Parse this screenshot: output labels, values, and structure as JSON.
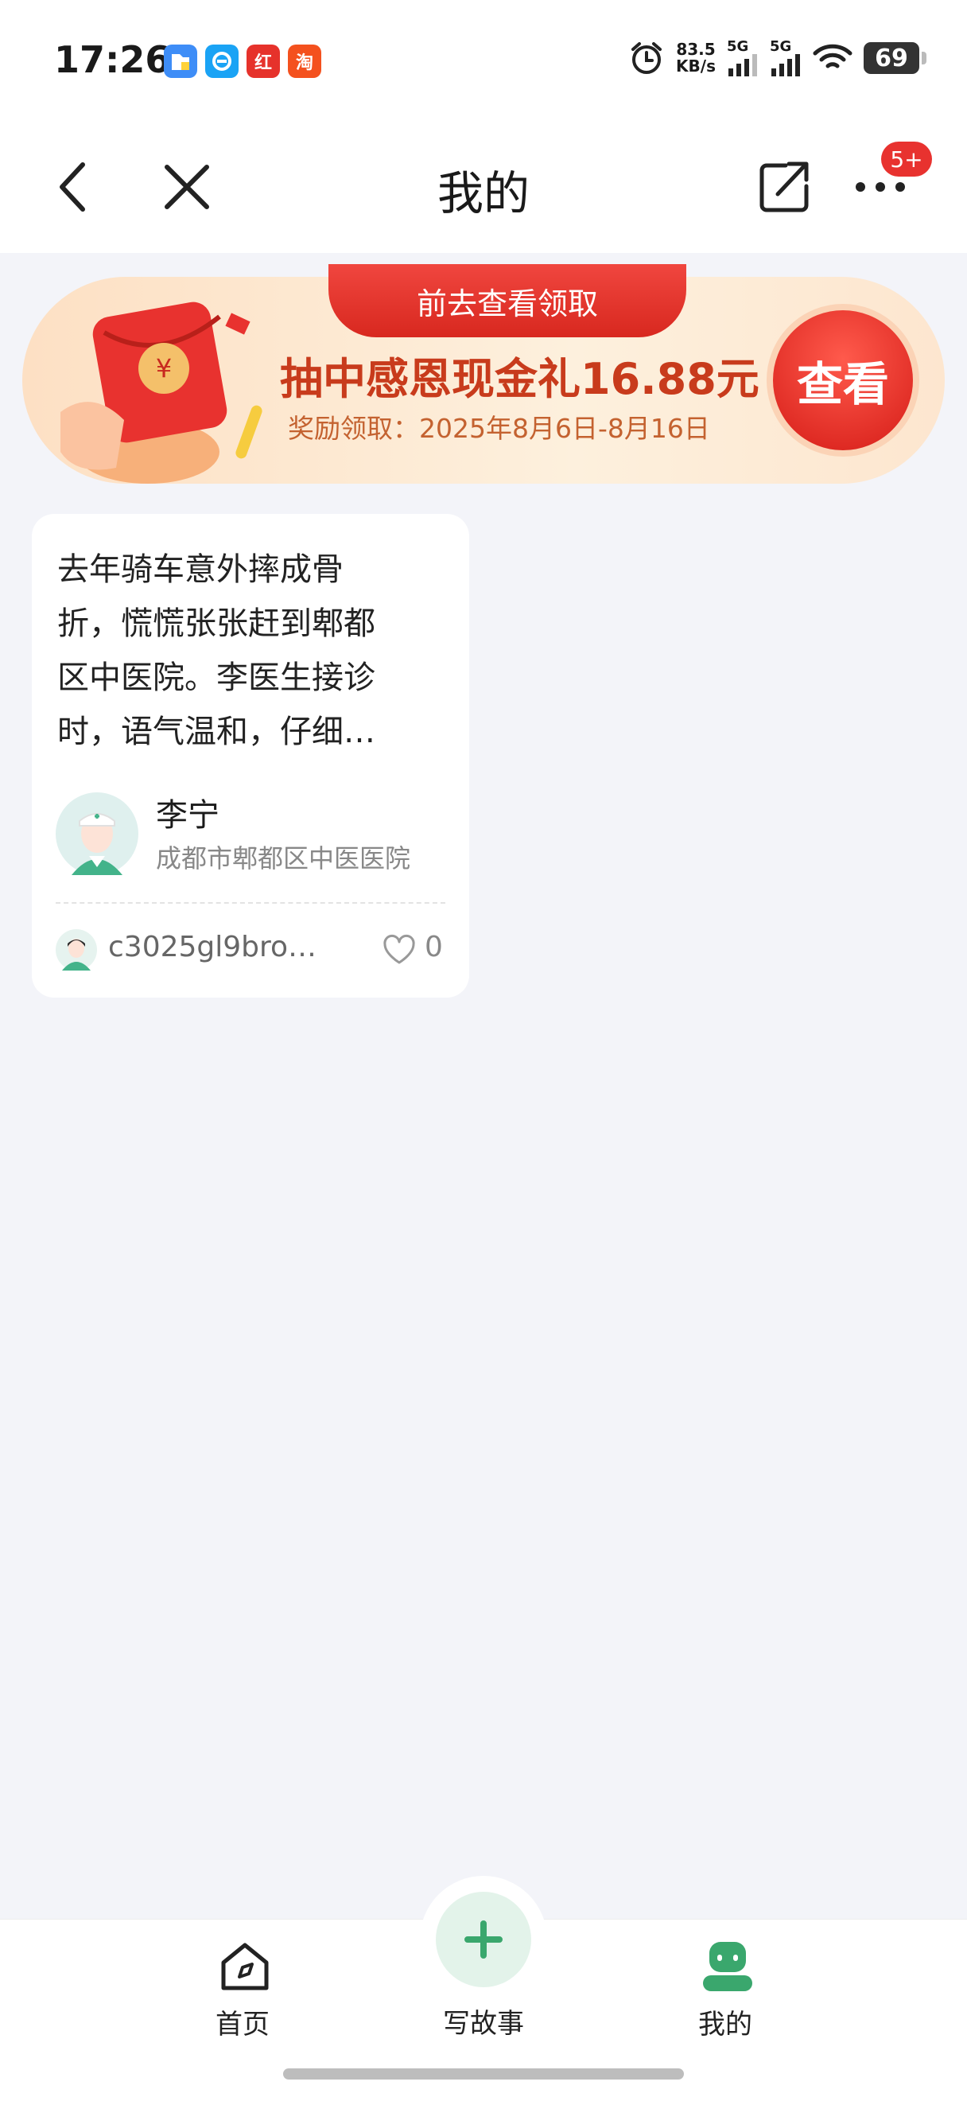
{
  "status_bar": {
    "time": "17:26",
    "app_icons": [
      {
        "name": "files-app-icon",
        "glyph": "",
        "color": "#3e8df7"
      },
      {
        "name": "browser-app-icon",
        "glyph": "e",
        "color": "#1aa3f5"
      },
      {
        "name": "red-app-icon",
        "glyph": "红",
        "color": "#e6322b"
      },
      {
        "name": "taobao-app-icon",
        "glyph": "淘",
        "color": "#f4511e"
      }
    ],
    "net_speed_value": "83.5",
    "net_speed_unit": "KB/s",
    "signal1_label": "5G",
    "signal2_label": "5G",
    "battery": "69"
  },
  "nav": {
    "title": "我的",
    "more_badge": "5+"
  },
  "banner": {
    "tab_text": "前去查看领取",
    "headline": "抽中感恩现金礼16.88元",
    "subline": "奖励领取：2025年8月6日-8月16日",
    "button_label": "查看"
  },
  "story_card": {
    "text_lines": [
      "去年骑车意外摔成骨",
      "折，慌慌张张赶到郫都",
      "区中医院。李医生接诊",
      "时，语气温和，仔细…"
    ],
    "doctor_name": "李宁",
    "hospital": "成都市郫都区中医医院",
    "author": "c3025gl9bro…",
    "likes": "0"
  },
  "tabbar": {
    "home_label": "首页",
    "write_label": "写故事",
    "mine_label": "我的"
  },
  "colors": {
    "accent_green": "#3aa76d",
    "banner_red": "#e8322f",
    "badge_red": "#e8322f"
  }
}
